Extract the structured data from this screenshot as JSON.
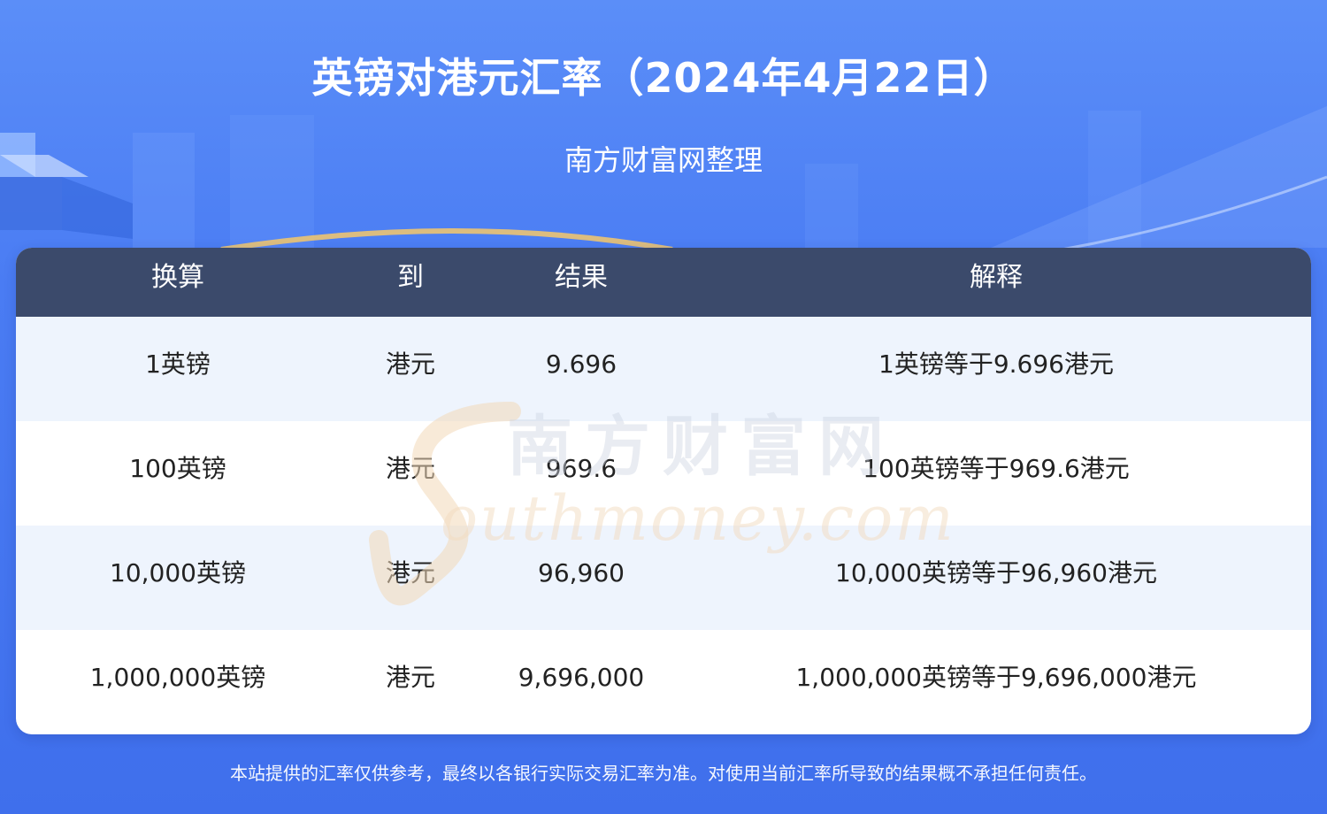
{
  "header": {
    "title": "英镑对港元汇率（2024年4月22日）",
    "subtitle": "南方财富网整理"
  },
  "table": {
    "columns": [
      "换算",
      "到",
      "结果",
      "解释"
    ],
    "rows": [
      {
        "amount": "1英镑",
        "to": "港元",
        "result": "9.696",
        "explain": "1英镑等于9.696港元"
      },
      {
        "amount": "100英镑",
        "to": "港元",
        "result": "969.6",
        "explain": "100英镑等于969.6港元"
      },
      {
        "amount": "10,000英镑",
        "to": "港元",
        "result": "96,960",
        "explain": "10,000英镑等于96,960港元"
      },
      {
        "amount": "1,000,000英镑",
        "to": "港元",
        "result": "9,696,000",
        "explain": "1,000,000英镑等于9,696,000港元"
      }
    ]
  },
  "watermark": {
    "cn": "南方财富网",
    "en": "Southmoney.com"
  },
  "footer": {
    "disclaimer": "本站提供的汇率仅供参考，最终以各银行实际交易汇率为准。对使用当前汇率所导致的结果概不承担任何责任。"
  },
  "colors": {
    "background": "#4a7cf3",
    "table_header": "#3b4a6b",
    "row_alt": "#eef4fd",
    "accent_curve": "#f6c86a"
  }
}
